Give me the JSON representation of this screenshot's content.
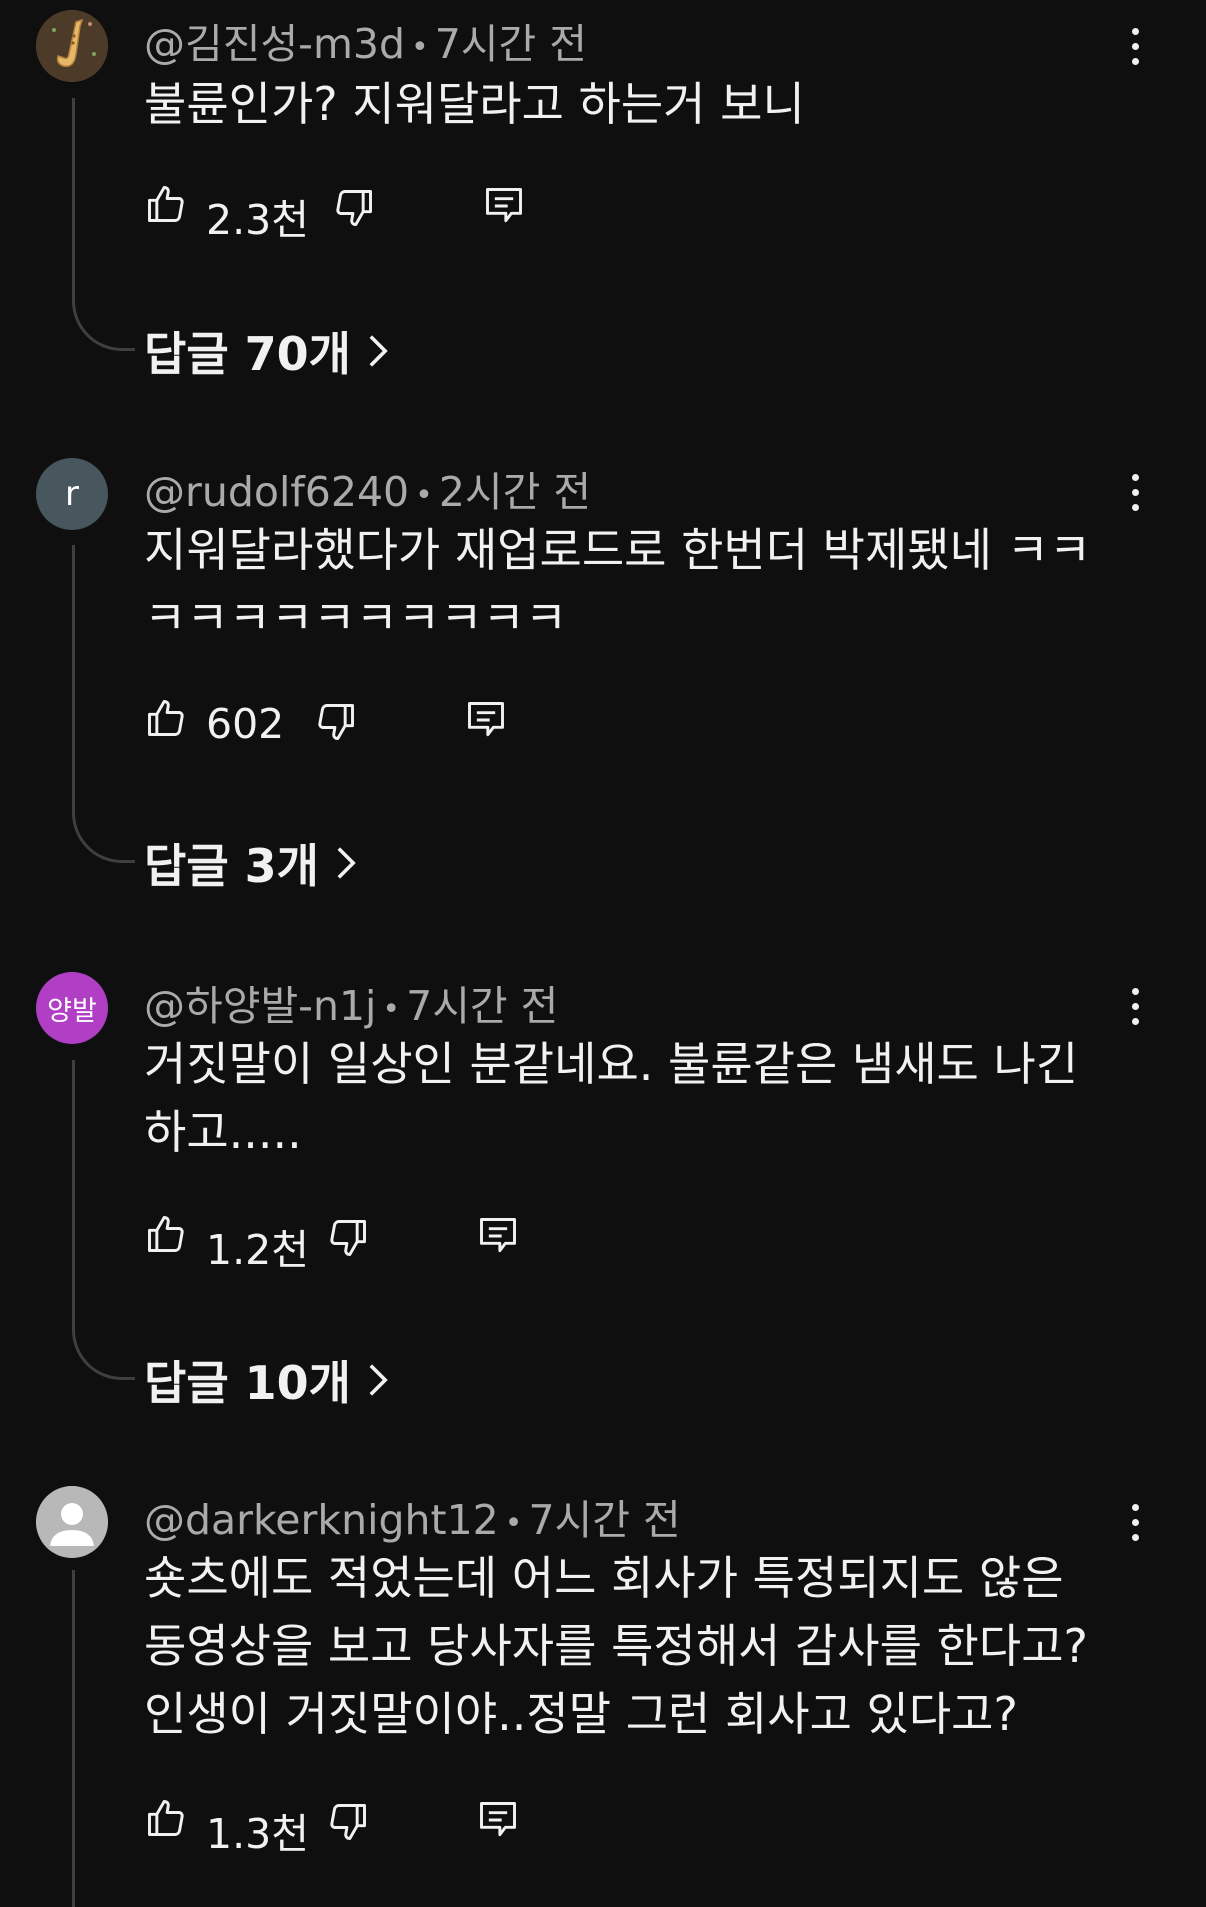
{
  "comments": [
    {
      "handle": "@김진성-m3d",
      "time": "7시간 전",
      "text": "불륜인가? 지워달라고 하는거 보니",
      "likes": "2.3천",
      "replies_label": "답글 70개",
      "avatar": "saxophone-avatar"
    },
    {
      "handle": "@rudolf6240",
      "time": "2시간 전",
      "text": "지워달라했다가 재업로드로 한번더 박제됐네 ㅋㅋㅋㅋㅋㅋㅋㅋㅋㅋㅋㅋ",
      "likes": "602",
      "replies_label": "답글 3개",
      "avatar_letter": "r"
    },
    {
      "handle": "@하양발-n1j",
      "time": "7시간 전",
      "text": "거짓말이 일상인 분같네요. 불륜같은 냄새도 나긴하고.....",
      "likes": "1.2천",
      "replies_label": "답글 10개",
      "avatar_letter": "양발"
    },
    {
      "handle": "@darkerknight12",
      "time": "7시간 전",
      "text": "숏츠에도 적었는데 어느 회사가 특정되지도 않은 동영상을 보고 당사자를 특정해서 감사를 한다고? 인생이 거짓말이야..정말 그런 회사고 있다고?",
      "likes": "1.3천",
      "avatar": "default-user-avatar"
    }
  ],
  "colors": {
    "background": "#0f0f0f",
    "text": "#f1f1f1",
    "secondary_text": "#aaaaaa",
    "thread_line": "#3f3f3f",
    "avatar_r": "#48575e",
    "avatar_yb": "#b13fc6"
  }
}
